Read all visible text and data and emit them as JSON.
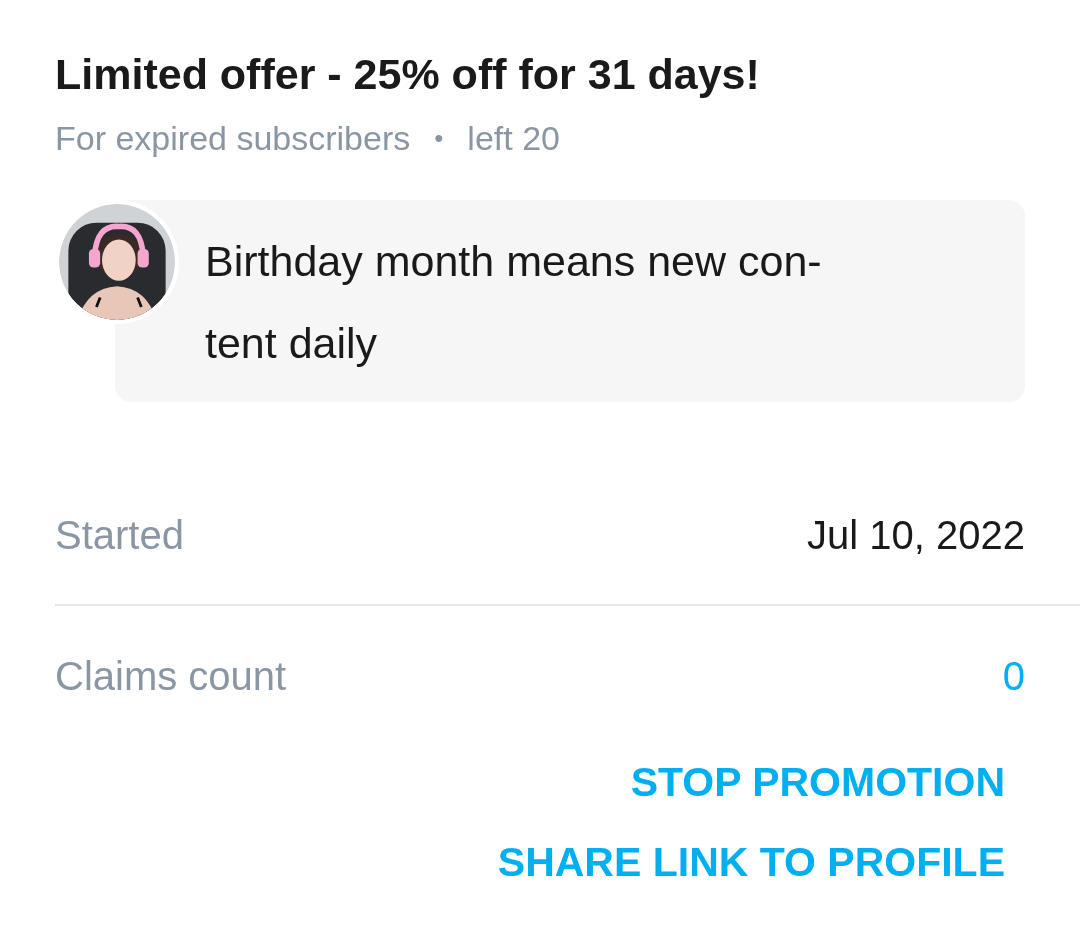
{
  "offer": {
    "title": "Limited offer - 25% off for 31 days!",
    "audience": "For expired subscribers",
    "separator": "•",
    "remaining": "left 20"
  },
  "message": {
    "text": "Birthday month means new con-tent daily"
  },
  "details": [
    {
      "label": "Started",
      "value": "Jul 10, 2022",
      "kind": "plain"
    },
    {
      "label": "Claims count",
      "value": "0",
      "kind": "link"
    }
  ],
  "actions": [
    "STOP PROMOTION",
    "SHARE LINK TO PROFILE"
  ]
}
